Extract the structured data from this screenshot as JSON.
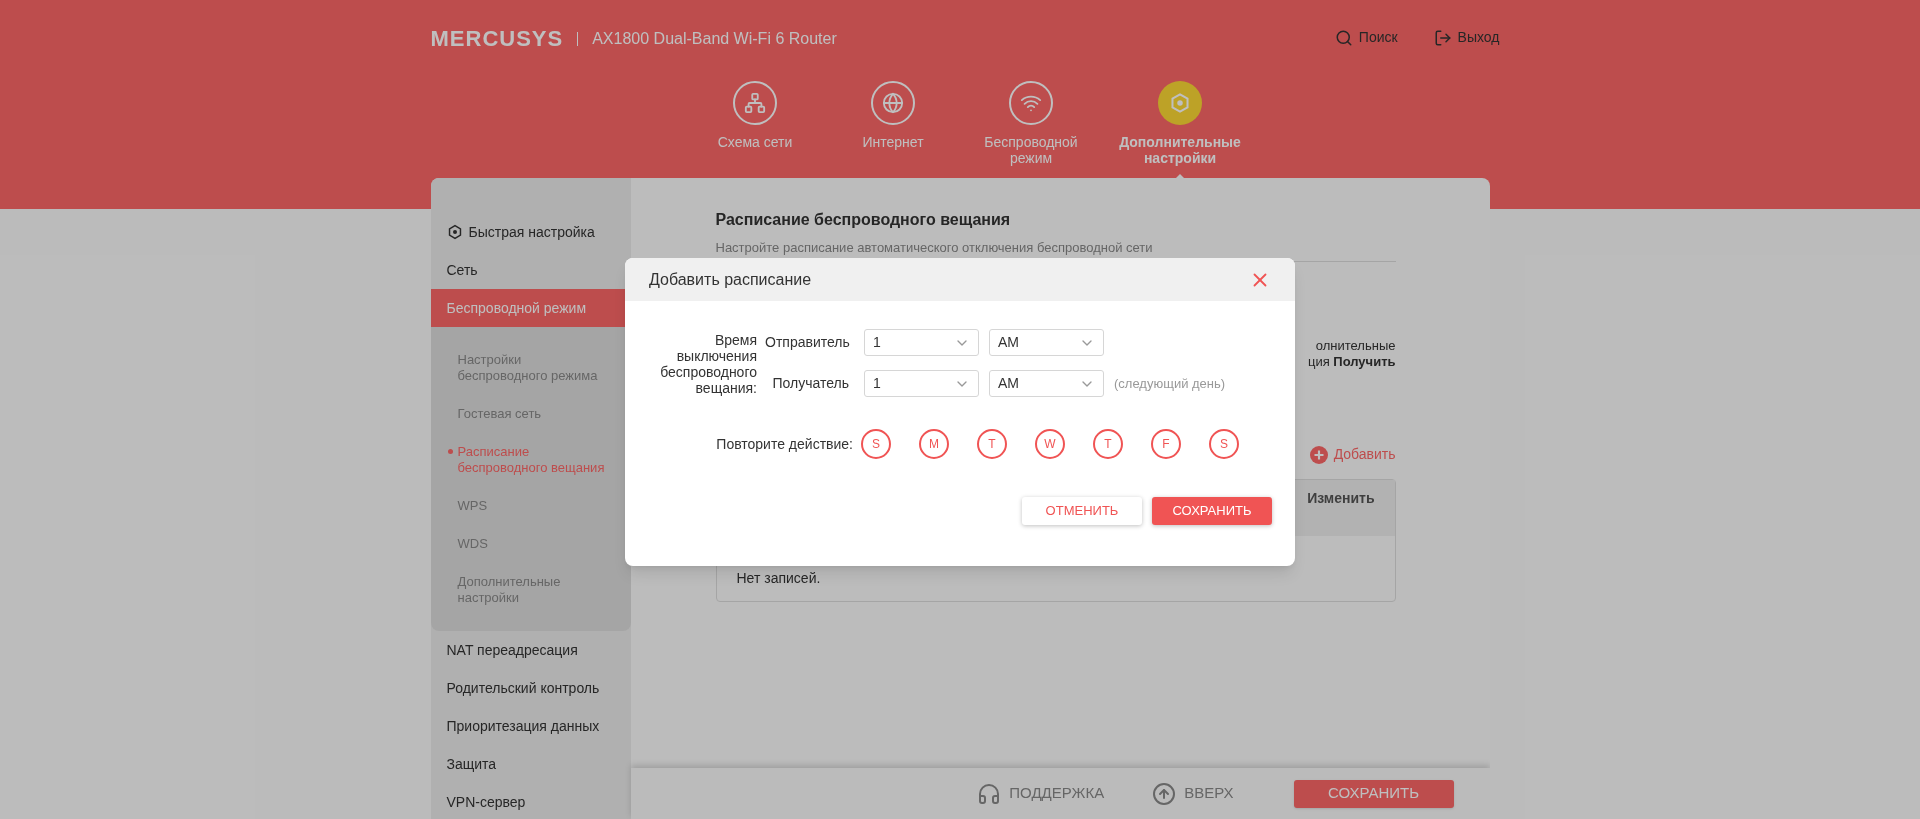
{
  "header": {
    "logo": "MERCUSYS",
    "model": "AX1800 Dual-Band Wi-Fi 6 Router",
    "actions": [
      {
        "kind": "search",
        "label": "Поиск"
      },
      {
        "kind": "logout",
        "label": "Выход"
      }
    ]
  },
  "nav": [
    {
      "kind": "network",
      "label": "Схема сети",
      "selected": false
    },
    {
      "kind": "internet",
      "label": "Интернет",
      "selected": false
    },
    {
      "kind": "wireless",
      "label": "Беспроводной режим",
      "selected": false
    },
    {
      "kind": "advanced",
      "label": "Дополнительные настройки",
      "selected": true
    }
  ],
  "sidebar": [
    {
      "label": "Быстрая настройка",
      "kind": "quick",
      "selected": false
    },
    {
      "label": "Сеть",
      "selected": false
    },
    {
      "label": "Беспроводной режим",
      "selected": true,
      "expanded": true,
      "children": [
        {
          "label": "Настройки беспроводного режима",
          "selected": false
        },
        {
          "label": "Гостевая сеть",
          "selected": false
        },
        {
          "label": "Расписание беспроводного вещания",
          "selected": true
        },
        {
          "label": "WPS",
          "selected": false
        },
        {
          "label": "WDS",
          "selected": false
        },
        {
          "label": "Дополнительные настройки",
          "selected": false
        }
      ]
    },
    {
      "label": "NAT переадресация",
      "selected": false
    },
    {
      "label": "Родительский контроль",
      "selected": false
    },
    {
      "label": "Приоритезация данных",
      "selected": false
    },
    {
      "label": "Защита",
      "selected": false
    },
    {
      "label": "VPN-сервер",
      "selected": false
    }
  ],
  "content": {
    "title": "Расписание беспроводного вещания",
    "description": "Настройте расписание автоматического отключения беспроводной сети",
    "partial_lines": [
      "олнительные",
      "ция **Получить**"
    ],
    "add_button": "Добавить",
    "table": {
      "columns": [
        "Изменить"
      ],
      "empty_text": "Нет записей."
    }
  },
  "bottom_bar": {
    "support": "ПОДДЕРЖКА",
    "top": "ВВЕРХ",
    "save": "СОХРАНИТЬ"
  },
  "dialog": {
    "title": "Добавить расписание",
    "time_label": "Время выключения беспроводного вещания:",
    "rows": [
      {
        "label": "Отправитель",
        "hour": "1",
        "period": "AM"
      },
      {
        "label": "Получатель",
        "hour": "1",
        "period": "AM",
        "note": "(следующий день)"
      }
    ],
    "repeat_label": "Повторите действие:",
    "days": [
      {
        "label": "S",
        "selected": false
      },
      {
        "label": "M",
        "selected": false
      },
      {
        "label": "T",
        "selected": false
      },
      {
        "label": "W",
        "selected": false
      },
      {
        "label": "T",
        "selected": false
      },
      {
        "label": "F",
        "selected": false
      },
      {
        "label": "S",
        "selected": false
      }
    ],
    "cancel": "ОТМЕНИТЬ",
    "save": "СОХРАНИТЬ"
  }
}
